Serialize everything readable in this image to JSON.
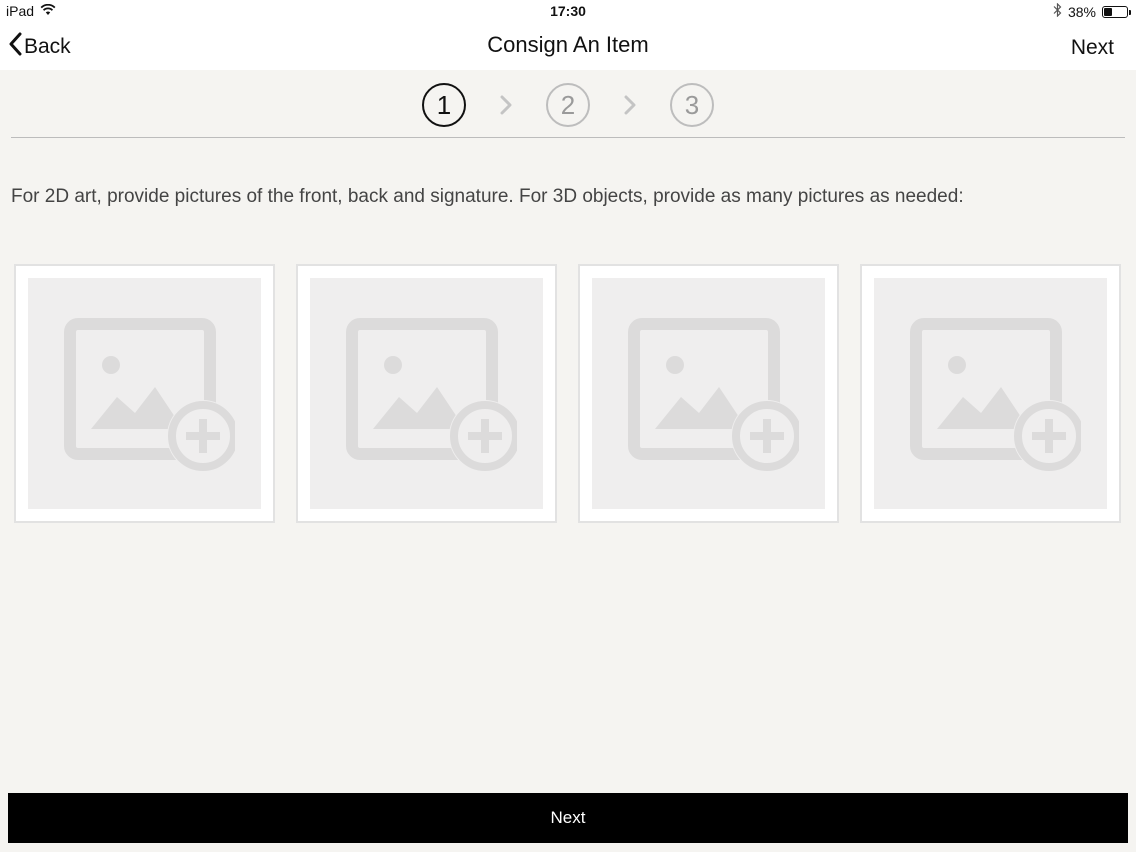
{
  "status": {
    "device": "iPad",
    "time": "17:30",
    "battery": "38%",
    "battery_level": 0.38,
    "icons": [
      "wifi-icon",
      "bluetooth-icon",
      "battery-icon"
    ]
  },
  "nav": {
    "back_label": "Back",
    "title": "Consign An Item",
    "next_label": "Next"
  },
  "steps": [
    {
      "number": "1",
      "active": true
    },
    {
      "number": "2",
      "active": false
    },
    {
      "number": "3",
      "active": false
    }
  ],
  "instructions": "For 2D art, provide pictures of the front, back and signature.  For 3D objects, provide as many pictures as needed:",
  "photo_slots": [
    {
      "icon": "add-photo-icon"
    },
    {
      "icon": "add-photo-icon"
    },
    {
      "icon": "add-photo-icon"
    },
    {
      "icon": "add-photo-icon"
    }
  ],
  "bottom_button": {
    "label": "Next"
  },
  "colors": {
    "background": "#f5f4f1",
    "button": "#000000",
    "placeholder": "#e0dfdf"
  }
}
